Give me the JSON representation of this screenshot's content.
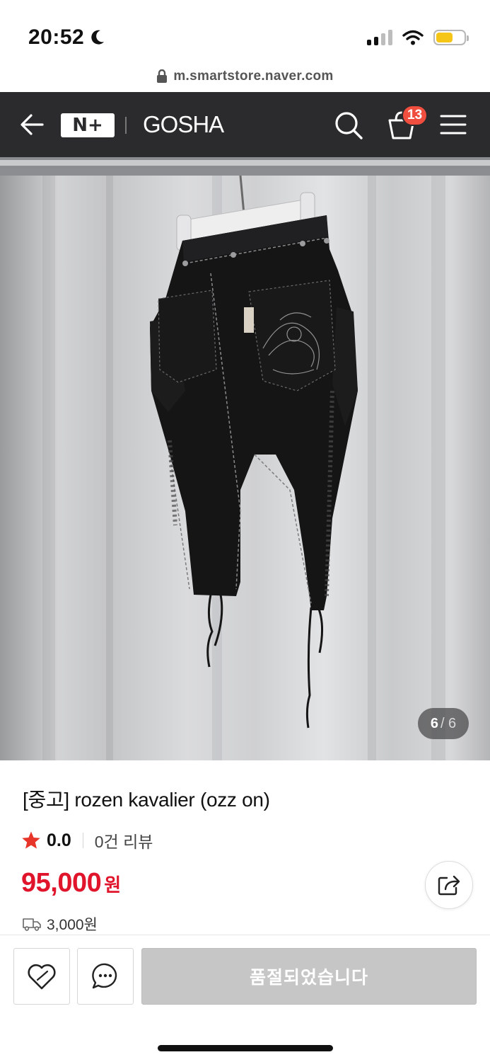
{
  "status_bar": {
    "time": "20:52",
    "battery_level": 0.6,
    "battery_color": "#f5c518"
  },
  "browser": {
    "url": "m.smartstore.naver.com"
  },
  "nav": {
    "logo": "N+",
    "brand": "GOSHA",
    "cart_count": "13",
    "background": "#2b2b2d",
    "icons": [
      "back-arrow-icon",
      "search-icon",
      "cart-icon",
      "menu-icon"
    ]
  },
  "gallery": {
    "current": "6",
    "total": "/ 6"
  },
  "product": {
    "title": "[중고] rozen kavalier (ozz on)",
    "rating": "0.0",
    "review_count": "0건 리뷰",
    "price": "95,000",
    "currency": "원",
    "shipping_fee": "3,000원",
    "price_color": "#e0142b",
    "star_color": "#e8352a"
  },
  "actions": {
    "soldout_label": "품절되었습니다",
    "icons": [
      "wishlist-heart-icon",
      "talk-chat-icon",
      "share-icon"
    ]
  }
}
